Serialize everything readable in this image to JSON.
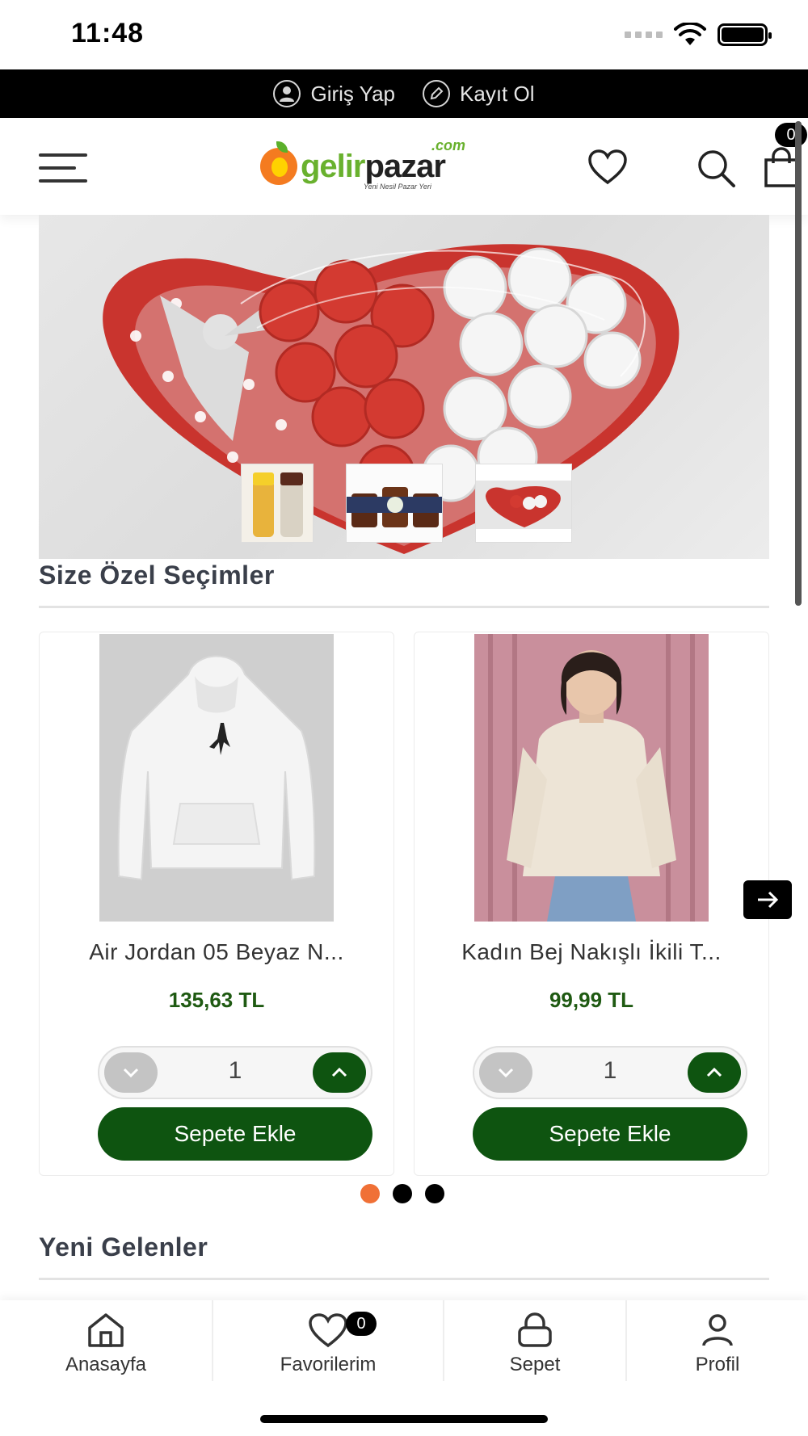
{
  "status_bar": {
    "time": "11:48"
  },
  "auth_bar": {
    "login_label": "Giriş Yap",
    "register_label": "Kayıt Ol"
  },
  "header": {
    "logo_text_green": "gelir",
    "logo_text_dark": "pazar",
    "logo_com": ".com",
    "logo_tagline": "Yeni Nesil Pazar Yeri",
    "cart_count": "0"
  },
  "hero": {
    "thumbnails": [
      "spice-jars",
      "honey-jars",
      "heart-rose-box"
    ],
    "active_thumbnail": 2
  },
  "sections": {
    "picks_title": "Size Özel Seçimler",
    "new_title": "Yeni Gelenler"
  },
  "products": [
    {
      "name": "Air Jordan 05 Beyaz N...",
      "price": "135,63 TL",
      "quantity": "1",
      "add_label": "Sepete Ekle"
    },
    {
      "name": "Kadın Bej Nakışlı İkili T...",
      "price": "99,99 TL",
      "quantity": "1",
      "add_label": "Sepete Ekle"
    }
  ],
  "carousel": {
    "page_count": 3,
    "active_page": 0
  },
  "colors": {
    "accent_green": "#0e5410",
    "price_green": "#1f5a12",
    "active_dot": "#f07036"
  },
  "bottom_nav": {
    "home": "Anasayfa",
    "favorites": "Favorilerim",
    "favorites_count": "0",
    "cart": "Sepet",
    "profile": "Profil"
  }
}
